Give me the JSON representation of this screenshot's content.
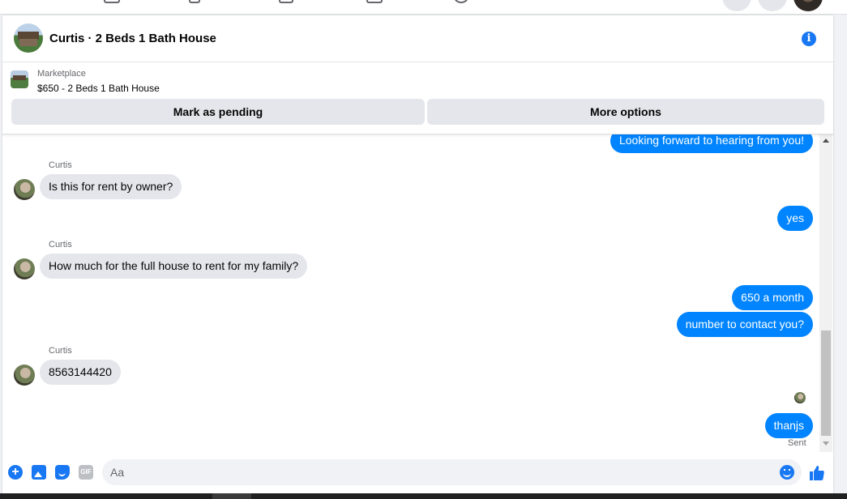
{
  "header": {
    "title": "Curtis · 2 Beds 1 Bath House",
    "info_icon": "info-icon"
  },
  "listing": {
    "source": "Marketplace",
    "price_title": "$650 - 2 Beds 1 Bath House",
    "mark_pending_label": "Mark as pending",
    "more_options_label": "More options"
  },
  "messages": [
    {
      "from": "me",
      "text": "Looking forward to hearing from you!"
    },
    {
      "from": "Curtis",
      "sender": "Curtis",
      "text": "Is this for rent by owner?"
    },
    {
      "from": "me",
      "text": "yes"
    },
    {
      "from": "Curtis",
      "sender": "Curtis",
      "text": "How much for the full house to rent for my family?"
    },
    {
      "from": "me",
      "text": "650 a month"
    },
    {
      "from": "me",
      "text": "number to contact you?"
    },
    {
      "from": "Curtis",
      "sender": "Curtis",
      "text": "8563144420"
    },
    {
      "from": "me",
      "text": "thanjs",
      "status": "Sent"
    }
  ],
  "composer": {
    "placeholder": "Aa",
    "gif_label": "GIF",
    "plus_label": "+",
    "info_glyph": "i"
  },
  "colors": {
    "accent": "#1877f2",
    "outgoing_bubble": "#0084ff",
    "incoming_bubble": "#e4e6eb"
  }
}
